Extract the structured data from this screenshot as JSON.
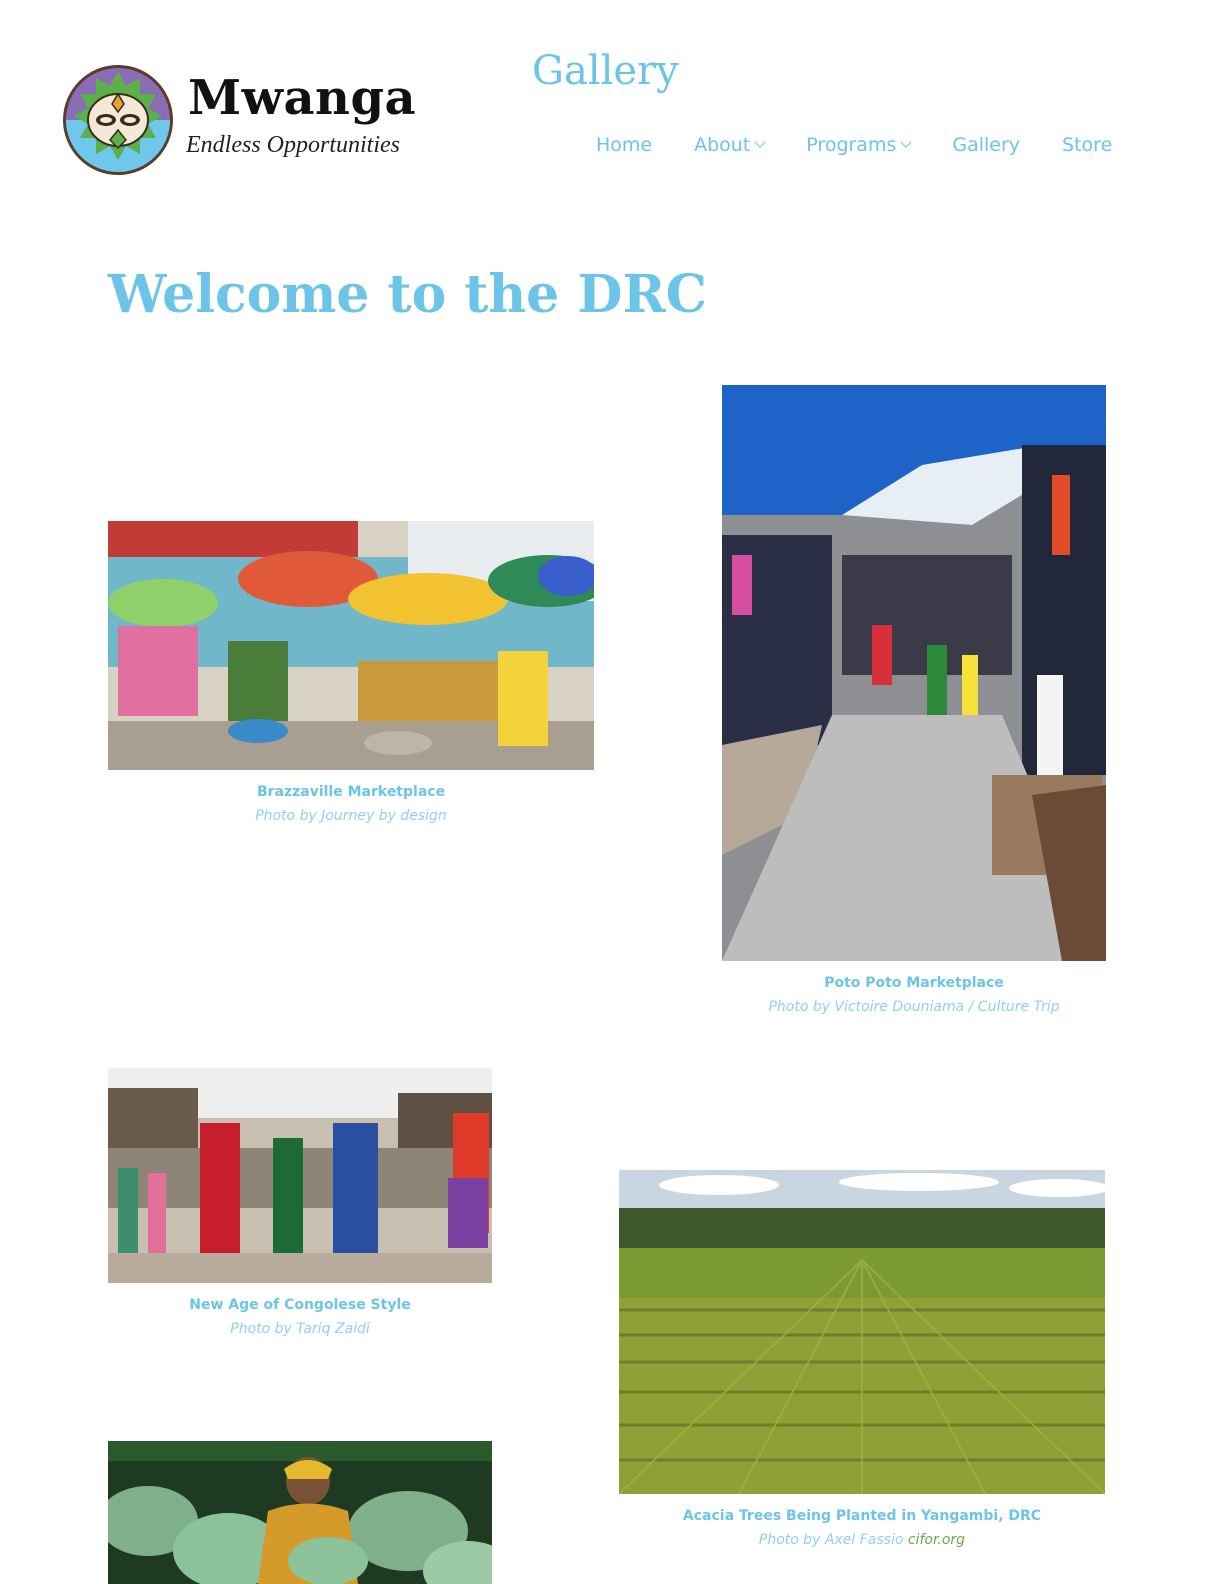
{
  "brand": {
    "name": "Mwanga",
    "tagline": "Endless Opportunities"
  },
  "header": {
    "page_title": "Gallery"
  },
  "nav": {
    "items": [
      {
        "label": "Home",
        "has_dropdown": false
      },
      {
        "label": "About",
        "has_dropdown": true
      },
      {
        "label": "Programs",
        "has_dropdown": true
      },
      {
        "label": "Gallery",
        "has_dropdown": false
      },
      {
        "label": "Store",
        "has_dropdown": false
      }
    ]
  },
  "main": {
    "heading": "Welcome to the DRC",
    "gallery": [
      {
        "title": "Brazzaville Marketplace",
        "credit": "Photo by Journey by design",
        "image": "colorful-market-umbrellas"
      },
      {
        "title": "Poto Poto Marketplace",
        "credit": "Photo by Victoire Douniama / Culture Trip",
        "image": "covered-market-aisle"
      },
      {
        "title": "New Age of Congolese Style",
        "credit": "Photo by Tariq Zaidi",
        "image": "sapeurs-street"
      },
      {
        "title": "Acacia Trees Being Planted in Yangambi, DRC",
        "credit": "Photo by Axel Fassio",
        "credit_link": "cifor.org",
        "image": "aerial-field-rows"
      },
      {
        "title": "",
        "credit": "",
        "image": "woman-cabbage-field"
      }
    ]
  },
  "colors": {
    "accent": "#6cc4e8",
    "link_green": "#6aa84f",
    "text_dark": "#111111"
  }
}
